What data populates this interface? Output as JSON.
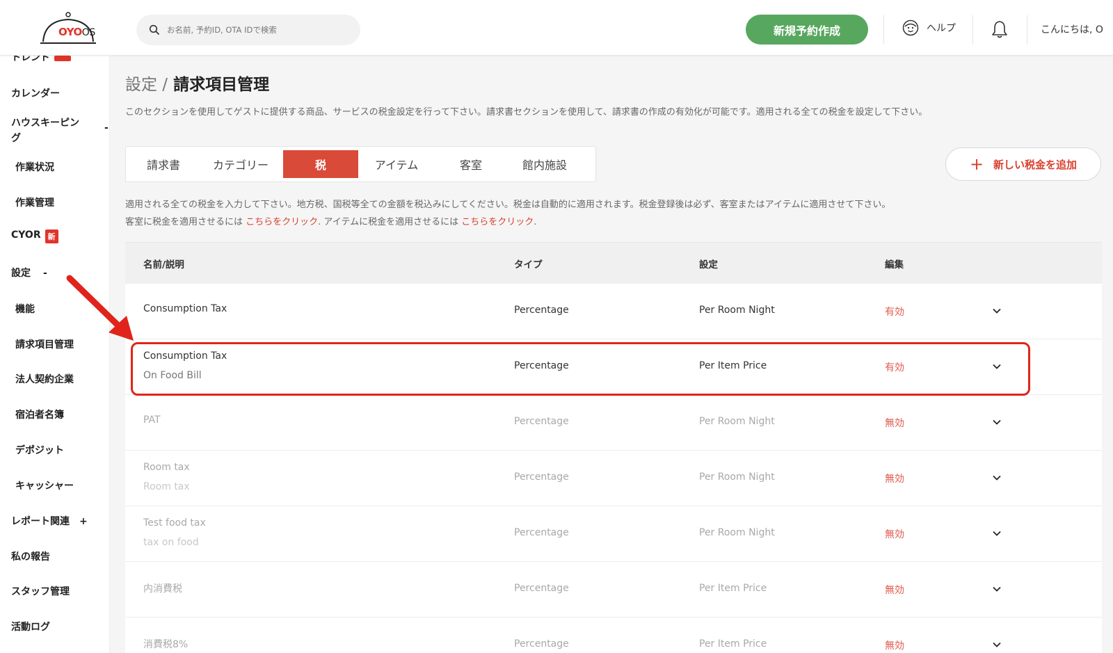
{
  "header": {
    "logo": {
      "brand": "OYO",
      "suffix": "OS"
    },
    "search_placeholder": "お名前, 予約ID, OTA IDで検索",
    "new_booking_label": "新規予約作成",
    "help_label": "ヘルプ",
    "greeting": "こんにちは, O"
  },
  "sidebar": {
    "items": [
      {
        "label": "トレンド"
      },
      {
        "label": "カレンダー"
      },
      {
        "label": "ハウスキーピン",
        "label2": "グ",
        "sign": "-"
      },
      {
        "label": "作業状況"
      },
      {
        "label": "作業管理"
      },
      {
        "label": "CYOR",
        "badge": "新"
      },
      {
        "label": "設定",
        "sign": "-"
      },
      {
        "label": "機能"
      },
      {
        "label": "請求項目管理"
      },
      {
        "label": "法人契約企業"
      },
      {
        "label": "宿泊者名簿"
      },
      {
        "label": "デポジット"
      },
      {
        "label": "キャッシャー"
      },
      {
        "label": "レポート関連",
        "sign": "+"
      },
      {
        "label": "私の報告"
      },
      {
        "label": "スタッフ管理"
      },
      {
        "label": "活動ログ"
      }
    ]
  },
  "main": {
    "breadcrumb_parent": "設定 /",
    "title": "請求項目管理",
    "description": "このセクションを使用してゲストに提供する商品、サービスの税金設定を行って下さい。請求書セクションを使用して、請求書の作成の有効化が可能です。適用される全ての税金を設定して下さい。",
    "tabs": [
      {
        "label": "請求書",
        "active": false
      },
      {
        "label": "カテゴリー",
        "active": false
      },
      {
        "label": "税",
        "active": true
      },
      {
        "label": "アイテム",
        "active": false
      },
      {
        "label": "客室",
        "active": false
      },
      {
        "label": "館内施設",
        "active": false
      }
    ],
    "add_tax_label": "新しい税金を追加",
    "add_tax_icon": "+",
    "info_line1": "適用される全ての税金を入力して下さい。地方税、国税等全ての金額を税込みにしてください。税金は自動的に適用されます。税金登録後は必ず、客室またはアイテムに適用させて下さい。",
    "info_line2_a": "客室に税金を適用させるには",
    "info_link1": "こちらをクリック",
    "info_line2_b": ". アイテムに税金を適用させるには",
    "info_link2": "こちらをクリック",
    "info_line2_c": ".",
    "table": {
      "headers": {
        "name": "名前/説明",
        "type": "タイプ",
        "setting": "設定",
        "edit": "編集"
      },
      "rows": [
        {
          "name": "Consumption Tax",
          "description": "",
          "type": "Percentage",
          "setting": "Per Room Night",
          "status": "有効",
          "active": true
        },
        {
          "name": "Consumption Tax",
          "description": "On Food Bill",
          "type": "Percentage",
          "setting": "Per Item Price",
          "status": "有効",
          "active": true
        },
        {
          "name": "PAT",
          "description": "",
          "type": "Percentage",
          "setting": "Per Room Night",
          "status": "無効",
          "active": false
        },
        {
          "name": "Room tax",
          "description": "Room tax",
          "type": "Percentage",
          "setting": "Per Room Night",
          "status": "無効",
          "active": false
        },
        {
          "name": "Test food tax",
          "description": "tax on food",
          "type": "Percentage",
          "setting": "Per Room Night",
          "status": "無効",
          "active": false
        },
        {
          "name": "内消費税",
          "description": "",
          "type": "Percentage",
          "setting": "Per Item Price",
          "status": "無効",
          "active": false
        },
        {
          "name": "消費税8%",
          "description": "",
          "type": "Percentage",
          "setting": "Per Item Price",
          "status": "無効",
          "active": false
        }
      ]
    }
  },
  "colors": {
    "accent_red": "#d94a38",
    "green_button": "#58a75f",
    "highlight_red": "#e0241b"
  },
  "icons": [
    "oyo-bell-logo-icon",
    "search-icon",
    "help-face-icon",
    "bell-icon",
    "plus-icon",
    "chevron-down-icon",
    "red-arrow-annotation"
  ]
}
